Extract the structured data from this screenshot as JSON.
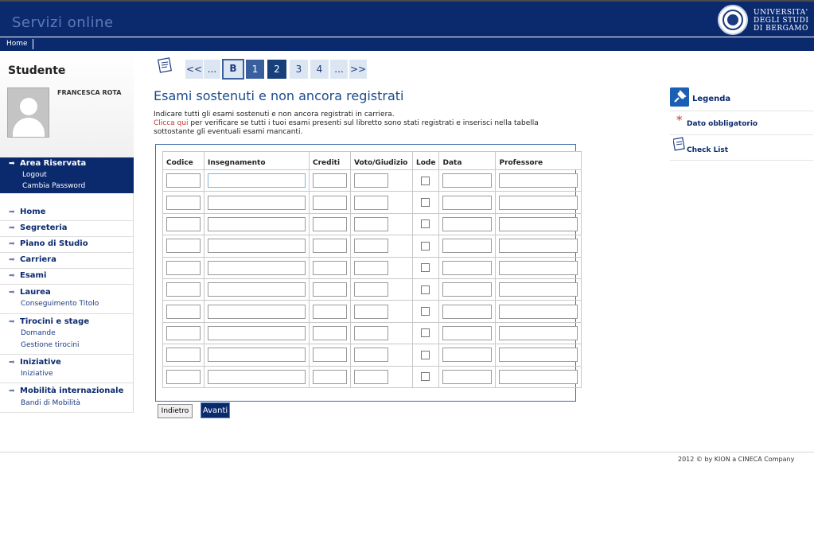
{
  "header": {
    "app_title": "Servizi online",
    "logo_line1": "UNIVERSITA'",
    "logo_line2": "DEGLI STUDI",
    "logo_line3": "DI BERGAMO",
    "brand_color": "#0b2a6e"
  },
  "nav": {
    "home": "Home"
  },
  "sidebar": {
    "title": "Studente",
    "user_name": "FRANCESCA ROTA",
    "area": {
      "title": "Area Riservata",
      "logout": "Logout",
      "change_password": "Cambia Password"
    },
    "menu": [
      {
        "label": "Home",
        "subs": []
      },
      {
        "label": "Segreteria",
        "subs": []
      },
      {
        "label": "Piano di Studio",
        "subs": []
      },
      {
        "label": "Carriera",
        "subs": []
      },
      {
        "label": "Esami",
        "subs": []
      },
      {
        "label": "Laurea",
        "subs": [
          "Conseguimento Titolo"
        ]
      },
      {
        "label": "Tirocini e stage",
        "subs": [
          "Domande",
          "Gestione tirocini"
        ]
      },
      {
        "label": "Iniziative",
        "subs": [
          "Iniziative"
        ]
      },
      {
        "label": "Mobilità internazionale",
        "subs": [
          "Bandi di Mobilità"
        ]
      }
    ]
  },
  "wizard": {
    "icon": "checklist-icon",
    "steps": [
      "<<",
      "...",
      "B",
      "1",
      "2",
      "3",
      "4",
      "...",
      ">>"
    ],
    "current_step": "2"
  },
  "main": {
    "title": "Esami sostenuti e non ancora registrati",
    "intro1": "Indicare tutti gli esami sostenuti e non ancora registrati in carriera.",
    "intro2_link": "Clicca qui",
    "intro2_rest": " per verificare se tutti i tuoi esami presenti sul libretto sono stati registrati e inserisci nella tabella sottostante gli eventuali esami mancanti.",
    "table": {
      "headers": [
        "Codice",
        "Insegnamento",
        "Crediti",
        "Voto/Giudizio",
        "Lode",
        "Data",
        "Professore"
      ],
      "row_count": 10
    },
    "back_button": "Indietro",
    "next_button": "Avanti"
  },
  "legend": {
    "title": "Legenda",
    "required": "Dato obbligatorio",
    "required_symbol": "*",
    "checklist": "Check List"
  },
  "footer": {
    "text": "2012 © by KION a CINECA Company"
  }
}
